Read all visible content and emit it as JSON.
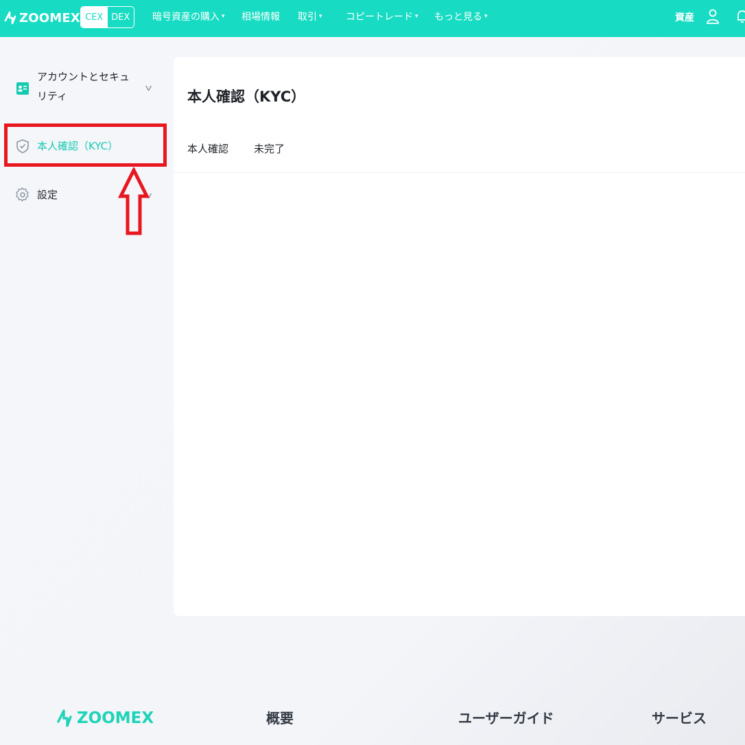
{
  "header": {
    "logo": "ZOOMEX",
    "switch": {
      "cex": "CEX",
      "dex": "DEX"
    },
    "nav": [
      {
        "label": "暗号資産の購入",
        "caret": "▾"
      },
      {
        "label": "相場情報",
        "caret": ""
      },
      {
        "label": "取引",
        "caret": "▾"
      },
      {
        "label": "コピートレード",
        "caret": "▾"
      },
      {
        "label": "もっと見る",
        "caret": "▾"
      }
    ],
    "assets": "資産",
    "icons": [
      "user-icon",
      "bell-icon"
    ],
    "bg_color": "#17dcc3"
  },
  "sidebar": {
    "items": [
      {
        "label": "アカウントとセキュリティ",
        "icon": "id-card-icon",
        "has_chevron": true,
        "active": false
      },
      {
        "label": "本人確認（KYC）",
        "icon": "shield-check-icon",
        "has_chevron": false,
        "active": true
      },
      {
        "label": "設定",
        "icon": "gear-icon",
        "has_chevron": true,
        "active": false
      }
    ],
    "chevron": "v",
    "accent_color": "#17c9b1"
  },
  "annotation": {
    "box_color": "#e8161f",
    "arrow": "up-arrow"
  },
  "main": {
    "title": "本人確認（KYC）",
    "rows": [
      {
        "label": "本人確認",
        "value": "未完了"
      }
    ]
  },
  "footer": {
    "logo": "ZOOMEX",
    "columns": [
      "概要",
      "ユーザーガイド",
      "サービス"
    ]
  }
}
